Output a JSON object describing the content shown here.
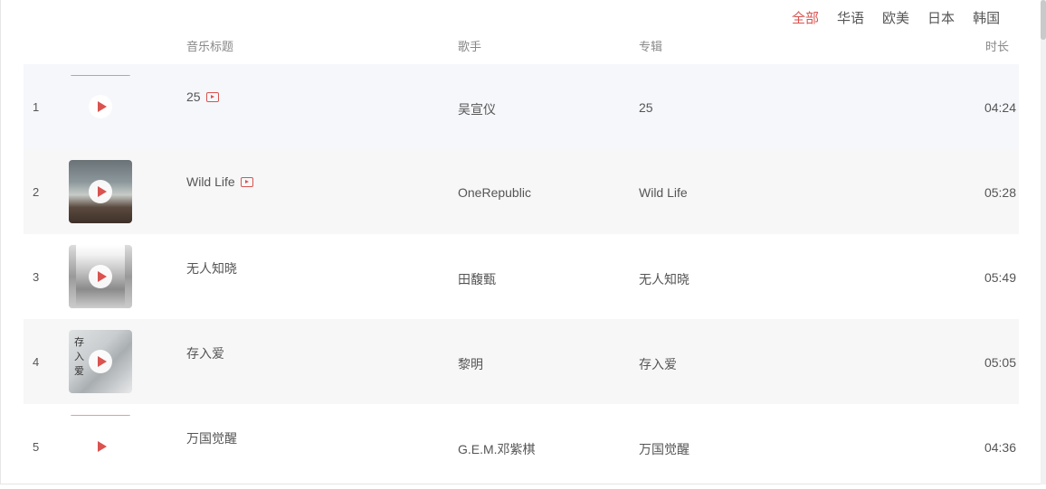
{
  "tabs": [
    {
      "label": "全部",
      "active": true
    },
    {
      "label": "华语",
      "active": false
    },
    {
      "label": "欧美",
      "active": false
    },
    {
      "label": "日本",
      "active": false
    },
    {
      "label": "韩国",
      "active": false
    }
  ],
  "header": {
    "title": "音乐标题",
    "singer": "歌手",
    "album": "专辑",
    "duration": "时长"
  },
  "songs": [
    {
      "index": "1",
      "title": "25",
      "has_mv": true,
      "singer": "吴宣仪",
      "album": "25",
      "duration": "04:24",
      "cover_icon": "blank-cover"
    },
    {
      "index": "2",
      "title": "Wild Life",
      "has_mv": true,
      "singer": "OneRepublic",
      "album": "Wild Life",
      "duration": "05:28",
      "cover_icon": "wave-rock-cover"
    },
    {
      "index": "3",
      "title": "无人知晓",
      "has_mv": false,
      "singer": "田馥甄",
      "album": "无人知晓",
      "duration": "05:49",
      "cover_icon": "mist-cover"
    },
    {
      "index": "4",
      "title": "存入爱",
      "has_mv": false,
      "singer": "黎明",
      "album": "存入爱",
      "duration": "05:05",
      "cover_icon": "portrait-cover",
      "cover_text": "存入爱"
    },
    {
      "index": "5",
      "title": "万国觉醒",
      "has_mv": false,
      "singer": "G.E.M.邓紫棋",
      "album": "万国觉醒",
      "duration": "04:36",
      "cover_icon": "blank-cover"
    }
  ],
  "colors": {
    "accent": "#d9534f",
    "row_alt": "#f7f7f8",
    "text": "#555555"
  }
}
